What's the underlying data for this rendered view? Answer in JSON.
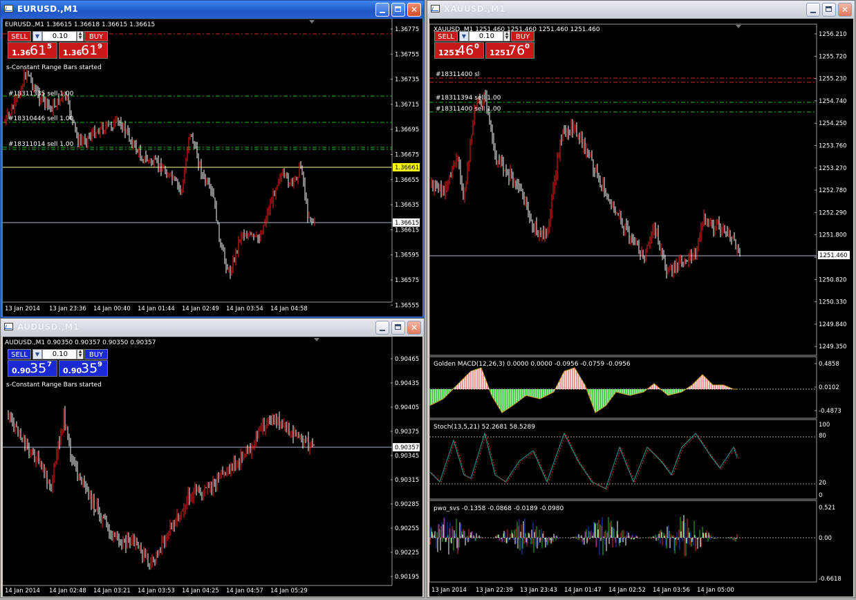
{
  "windows": {
    "eurusd": {
      "title": "EURUSD.,M1",
      "info": "EURUSD.,M1  1.36615 1.36618 1.36615 1.36615",
      "label_started": "s-Constant Range Bars started",
      "panel": {
        "sell": "SELL",
        "buy": "BUY",
        "lot": "0.10",
        "sell_prefix": "1.36",
        "sell_big": "61",
        "sell_sup": "5",
        "buy_prefix": "1.36",
        "buy_big": "61",
        "buy_sup": "9"
      },
      "order_labels": [
        "#18311335 sell 1.00",
        "#18310446 sell 1.00",
        "#18311014 sell 1.00"
      ],
      "y_ticks": [
        "1.36775",
        "1.36755",
        "1.36735",
        "1.36715",
        "1.36695",
        "1.36675",
        "1.36655",
        "1.36635",
        "1.36615",
        "1.36595",
        "1.36575",
        "1.36555"
      ],
      "x_ticks": [
        "13 Jan 2014",
        "13 Jan 23:36",
        "14 Jan 00:40",
        "14 Jan 01:44",
        "14 Jan 02:49",
        "14 Jan 03:54",
        "14 Jan 04:58"
      ],
      "price_tags": [
        "1.36661",
        "1.36615"
      ],
      "colors": {
        "up": "#ff2020",
        "down": "#ffffff",
        "panel": "#d42020"
      }
    },
    "audusd": {
      "title": "AUDUSD.,M1",
      "info": "AUDUSD.,M1  0.90350 0.90357 0.90350 0.90357",
      "label_started": "s-Constant Range Bars started",
      "panel": {
        "sell": "SELL",
        "buy": "BUY",
        "lot": "0.10",
        "sell_prefix": "0.90",
        "sell_big": "35",
        "sell_sup": "7",
        "buy_prefix": "0.90",
        "buy_big": "35",
        "buy_sup": "9"
      },
      "y_ticks": [
        "0.90465",
        "0.90435",
        "0.90405",
        "0.90375",
        "0.90345",
        "0.90315",
        "0.90285",
        "0.90255",
        "0.90225",
        "0.90195"
      ],
      "x_ticks": [
        "14 Jan 2014",
        "14 Jan 02:48",
        "14 Jan 03:21",
        "14 Jan 03:53",
        "14 Jan 04:25",
        "14 Jan 04:57",
        "14 Jan 05:29"
      ],
      "price_tags": [
        "0.90357"
      ],
      "colors": {
        "up": "#ff2020",
        "down": "#ffffff",
        "panel": "#1a2bd6"
      }
    },
    "xauusd": {
      "title": "XAUUSD.,M1",
      "info": "XAUUSD.,M1  1251.460 1251.460 1251.460 1251.460",
      "panel": {
        "sell": "SELL",
        "buy": "BUY",
        "lot": "0.10",
        "sell_prefix": "1251",
        "sell_big": "46",
        "sell_sup": "0",
        "buy_prefix": "1251",
        "buy_big": "76",
        "buy_sup": "0"
      },
      "order_labels": [
        "#18311400 sl",
        "#18311394 sell 1.00",
        "#18311400 sell 1.00"
      ],
      "y_ticks": [
        "1256.210",
        "1255.720",
        "1255.230",
        "1254.740",
        "1254.250",
        "1253.760",
        "1253.270",
        "1252.780",
        "1252.290",
        "1251.800",
        "1251.310",
        "1250.820",
        "1250.330",
        "1249.840",
        "1249.350"
      ],
      "x_ticks": [
        "13 Jan 2014",
        "13 Jan 22:39",
        "13 Jan 23:43",
        "14 Jan 01:47",
        "14 Jan 02:52",
        "14 Jan 03:56",
        "14 Jan 05:00"
      ],
      "price_tags": [
        "1251.460"
      ],
      "macd": {
        "label": "Golden MACD(12,26,3) 0.0000 0.0000 -0.0956 -0.0759 -0.0956",
        "ticks": [
          "0.4858",
          "0.0102",
          "-0.4873"
        ]
      },
      "stoch": {
        "label": "Stoch(13,5,21) 52.2681 58.5289",
        "ticks": [
          "100",
          "80",
          "20",
          "0"
        ]
      },
      "pwo": {
        "label": "pwo_svs -0.1358 -0.0868 -0.0189 -0.0980",
        "ticks": [
          "0.521",
          "0.00",
          "-0.6618"
        ]
      },
      "colors": {
        "up": "#ff2020",
        "down": "#ffffff",
        "panel": "#d42020"
      }
    }
  }
}
